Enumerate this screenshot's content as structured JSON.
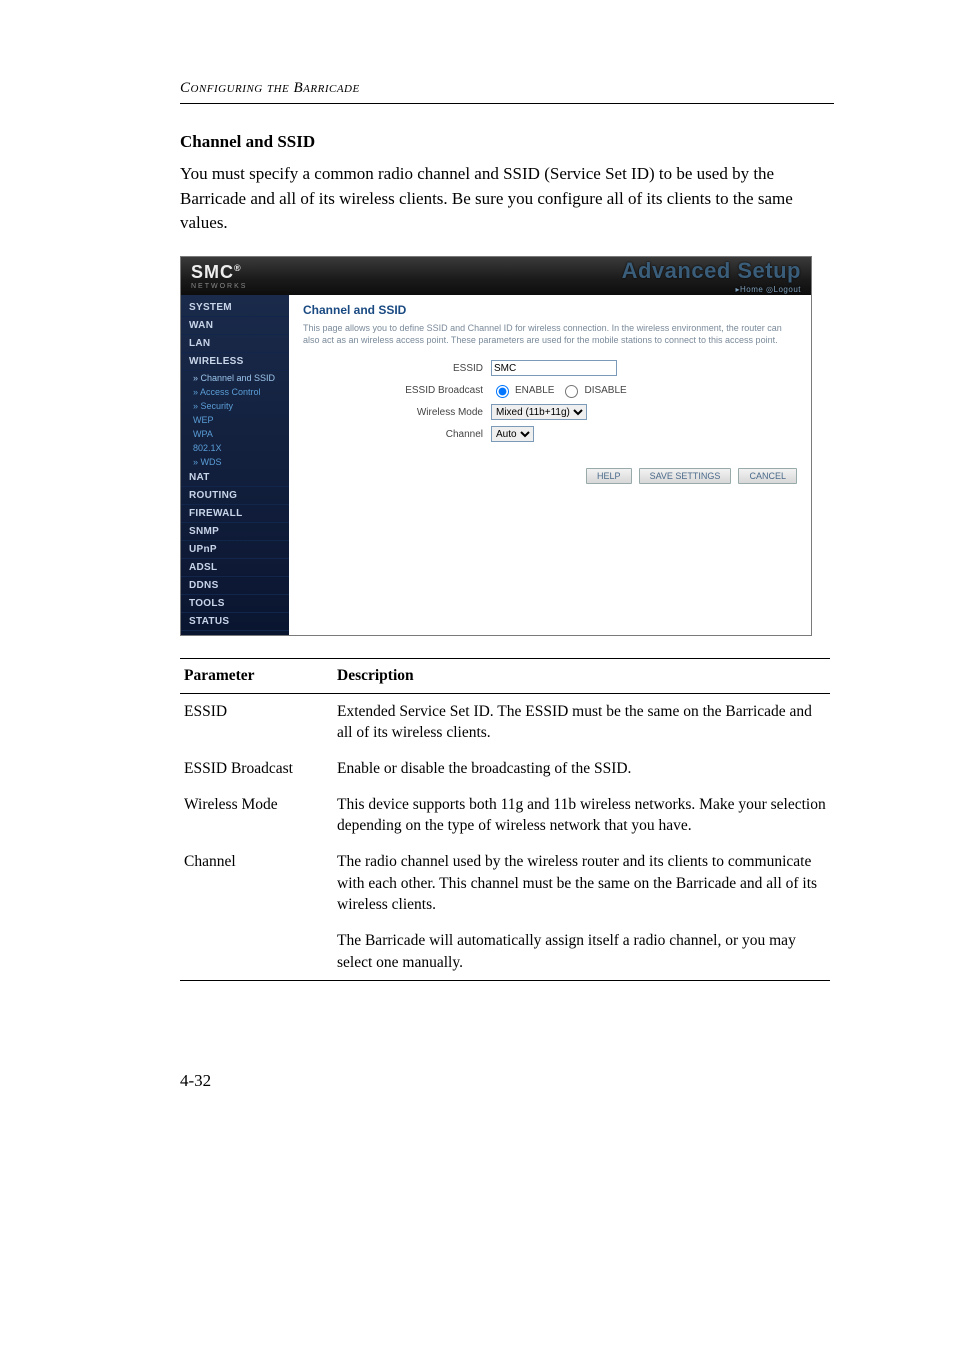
{
  "running_head": "Configuring the Barricade",
  "section_title": "Channel and SSID",
  "intro_text": "You must specify a common radio channel and SSID (Service Set ID) to be used by the Barricade and all of its wireless clients. Be sure you configure all of its clients to the same values.",
  "screenshot": {
    "logo": "SMC",
    "logo_sub": "NETWORKS",
    "brand": "Advanced Setup",
    "brand_links": "▸Home  ◎Logout",
    "nav": [
      "SYSTEM",
      "WAN",
      "LAN",
      "WIRELESS"
    ],
    "nav_sub": [
      "» Channel and SSID",
      "» Access Control",
      "» Security",
      "WEP",
      "WPA",
      "802.1X",
      "» WDS"
    ],
    "nav2": [
      "NAT",
      "ROUTING",
      "FIREWALL",
      "SNMP",
      "UPnP",
      "ADSL",
      "DDNS",
      "TOOLS",
      "STATUS"
    ],
    "panel_title": "Channel and SSID",
    "panel_desc": "This page allows you to define SSID and Channel ID for wireless connection. In the wireless environment, the router can also act as an wireless access point. These parameters are used for the mobile stations to connect to this access point.",
    "fields": {
      "essid_label": "ESSID",
      "essid_value": "SMC",
      "broadcast_label": "ESSID Broadcast",
      "broadcast_enable": "ENABLE",
      "broadcast_disable": "DISABLE",
      "mode_label": "Wireless Mode",
      "mode_value": "Mixed (11b+11g)",
      "channel_label": "Channel",
      "channel_value": "Auto"
    },
    "buttons": {
      "help": "HELP",
      "save": "SAVE SETTINGS",
      "cancel": "CANCEL"
    }
  },
  "table": {
    "head_param": "Parameter",
    "head_desc": "Description",
    "rows": [
      {
        "param": "ESSID",
        "desc": "Extended Service Set ID. The ESSID must be the same on the Barricade and all of its wireless clients."
      },
      {
        "param": "ESSID Broadcast",
        "desc": "Enable or disable the broadcasting of the SSID."
      },
      {
        "param": "Wireless Mode",
        "desc": "This device supports both 11g and 11b wireless networks. Make your selection depending on the type of wireless network that you have."
      },
      {
        "param": "Channel",
        "desc": "The radio channel used by the wireless router and its clients to communicate with each other. This channel must be the same on the Barricade and all of its wireless clients."
      },
      {
        "param": "",
        "desc": "The Barricade will automatically assign itself a radio channel, or you may select one manually."
      }
    ]
  },
  "page_number": "4-32"
}
